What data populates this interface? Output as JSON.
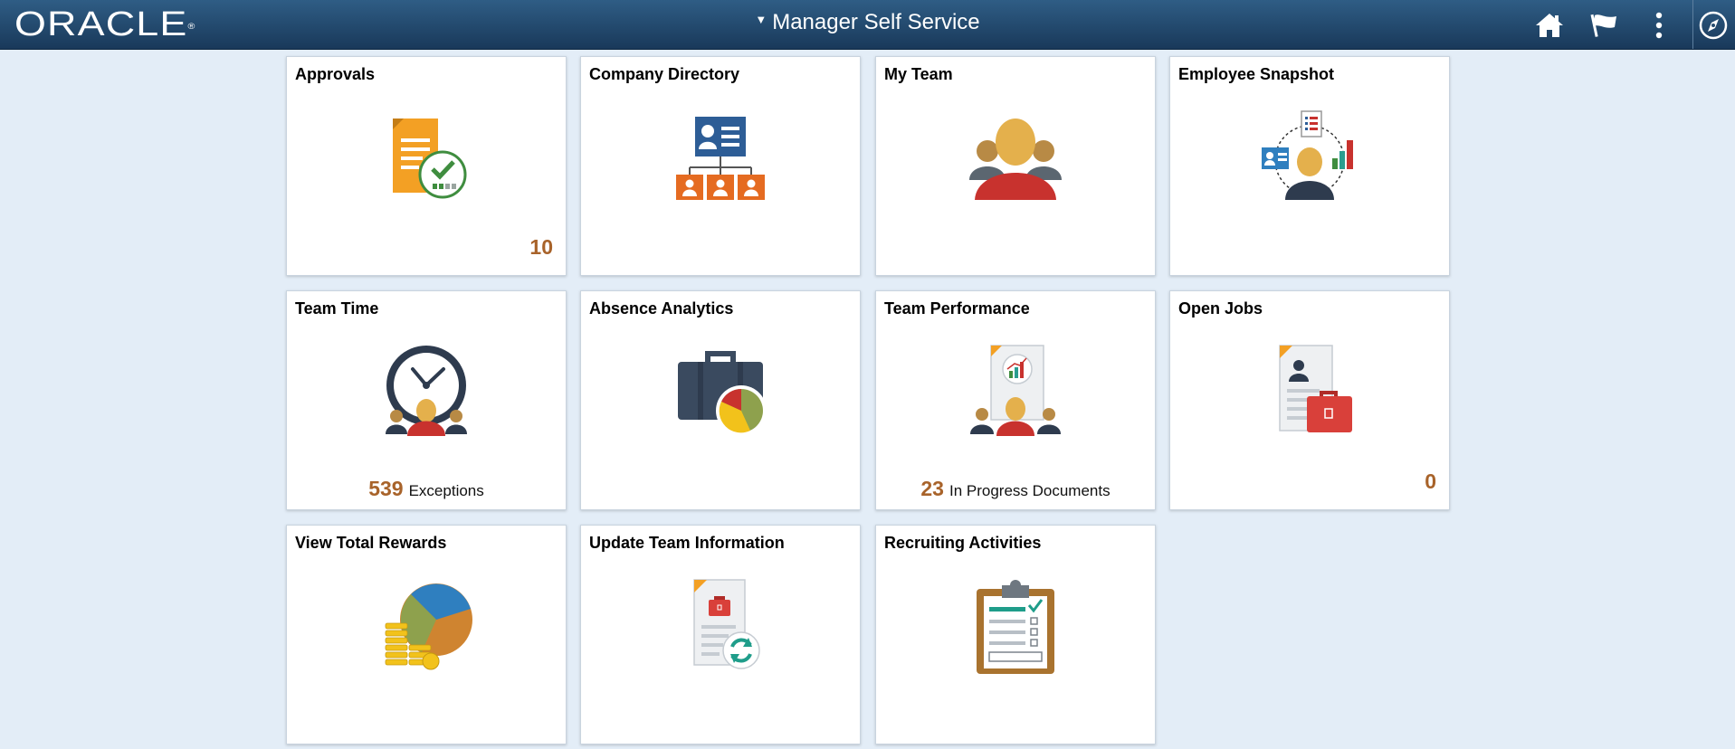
{
  "header": {
    "logo_text": "ORACLE",
    "logo_mark": "®",
    "title": "Manager Self Service",
    "caret": "▼",
    "icons": [
      "home-icon",
      "flag-icon",
      "more-vertical-icon",
      "navbar-compass-icon"
    ]
  },
  "colors": {
    "header_top": "#2f5d85",
    "header_bottom": "#19395a",
    "page_bg": "#e3edf7",
    "accent_count": "#a8632a"
  },
  "tiles": [
    {
      "title": "Approvals",
      "count": "10",
      "icon": "approvals-document-check-icon"
    },
    {
      "title": "Company Directory",
      "icon": "org-chart-icon"
    },
    {
      "title": "My Team",
      "icon": "team-people-icon"
    },
    {
      "title": "Employee Snapshot",
      "icon": "employee-snapshot-icon"
    },
    {
      "title": "Team Time",
      "count": "539",
      "status_label": "Exceptions",
      "icon": "clock-team-icon"
    },
    {
      "title": "Absence Analytics",
      "icon": "briefcase-pie-chart-icon"
    },
    {
      "title": "Team Performance",
      "count": "23",
      "status_label": "In Progress Documents",
      "icon": "performance-document-icon"
    },
    {
      "title": "Open Jobs",
      "count": "0",
      "icon": "job-posting-briefcase-icon"
    },
    {
      "title": "View Total Rewards",
      "icon": "rewards-pie-coins-icon"
    },
    {
      "title": "Update Team Information",
      "icon": "document-refresh-icon"
    },
    {
      "title": "Recruiting Activities",
      "icon": "clipboard-checklist-icon"
    }
  ]
}
